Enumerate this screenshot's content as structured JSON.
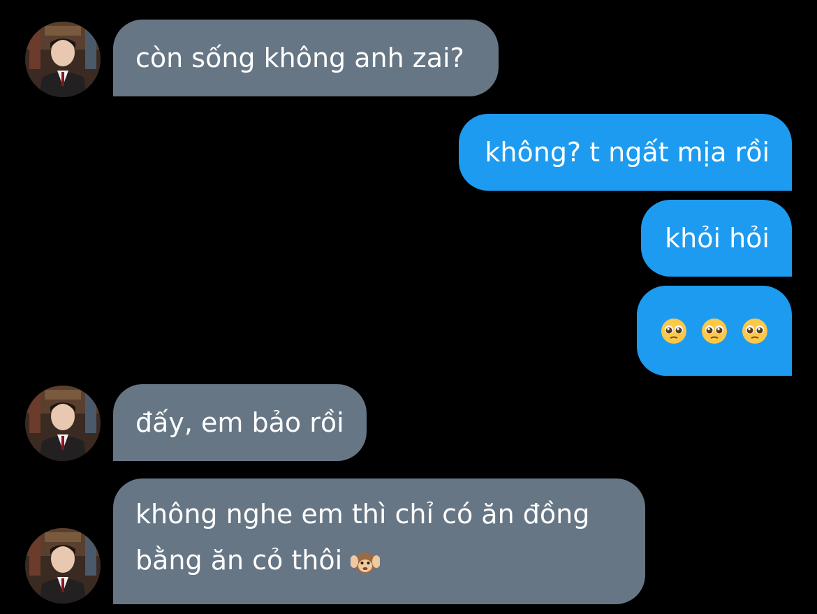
{
  "conversation": {
    "messages": [
      {
        "id": "m1",
        "sender": "contact",
        "text": "còn sống không anh zai?"
      },
      {
        "id": "m2",
        "sender": "me",
        "text": "không? t ngất mịa rồi"
      },
      {
        "id": "m3",
        "sender": "me",
        "text": "khỏi hỏi"
      },
      {
        "id": "m4",
        "sender": "me",
        "emoji": [
          "pleading-face",
          "pleading-face",
          "pleading-face"
        ]
      },
      {
        "id": "m5",
        "sender": "contact",
        "text": "đấy, em bảo rồi"
      },
      {
        "id": "m6",
        "sender": "contact",
        "text": "không nghe em thì chỉ có ăn đồng bằng ăn cỏ thôi",
        "trailing_emoji": "hear-no-evil-monkey"
      }
    ]
  },
  "colors": {
    "background": "#000000",
    "incoming_bubble": "#667685",
    "outgoing_bubble": "#1d9bf0",
    "text": "#ffffff"
  }
}
